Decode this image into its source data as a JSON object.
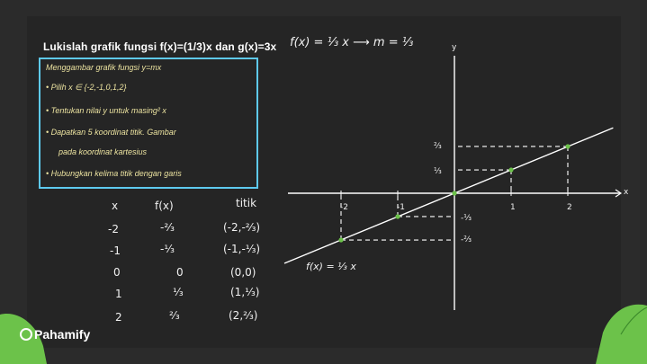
{
  "title": "Lukislah grafik fungsi f(x)=(1/3)x dan g(x)=3x",
  "top_formula": "f(x) = ⅓ x ⟶ m = ⅓",
  "steps": [
    "Menggambar grafik fungsi y=mx",
    "• Pilih x ∈ {-2,-1,0,1,2}",
    "• Tentukan nilai y untuk masing² x",
    "• Dapatkan 5 koordinat titik. Gambar",
    "pada koordinat kartesius",
    "• Hubungkan kelima titik dengan garis"
  ],
  "table": {
    "headers": [
      "x",
      "f(x)",
      "titik"
    ],
    "rows": [
      [
        "-2",
        "-²⁄₃",
        "(-2,-²⁄₃)"
      ],
      [
        "-1",
        "-¹⁄₃",
        "(-1,-¹⁄₃)"
      ],
      [
        "0",
        "0",
        "(0,0)"
      ],
      [
        "1",
        "¹⁄₃",
        "(1,¹⁄₃)"
      ],
      [
        "2",
        "²⁄₃",
        "(2,²⁄₃)"
      ]
    ]
  },
  "graph": {
    "y_axis_label": "y",
    "x_axis_label": "x",
    "x_ticks": [
      "-2",
      "-1",
      "1",
      "2"
    ],
    "y_ticks_pos": [
      "²⁄₃",
      "¹⁄₃"
    ],
    "y_ticks_neg": [
      "-¹⁄₃",
      "-²⁄₃"
    ],
    "line_label": "f(x) = ⅓ x",
    "points": [
      [
        -2,
        -0.667
      ],
      [
        -1,
        -0.333
      ],
      [
        0,
        0
      ],
      [
        1,
        0.333
      ],
      [
        2,
        0.667
      ]
    ]
  },
  "brand": "Pahamify",
  "colors": {
    "background": "#2b2b2b",
    "box_border": "#5ec9ee",
    "step_text": "#ece3a0",
    "leaf": "#6cc24a"
  }
}
